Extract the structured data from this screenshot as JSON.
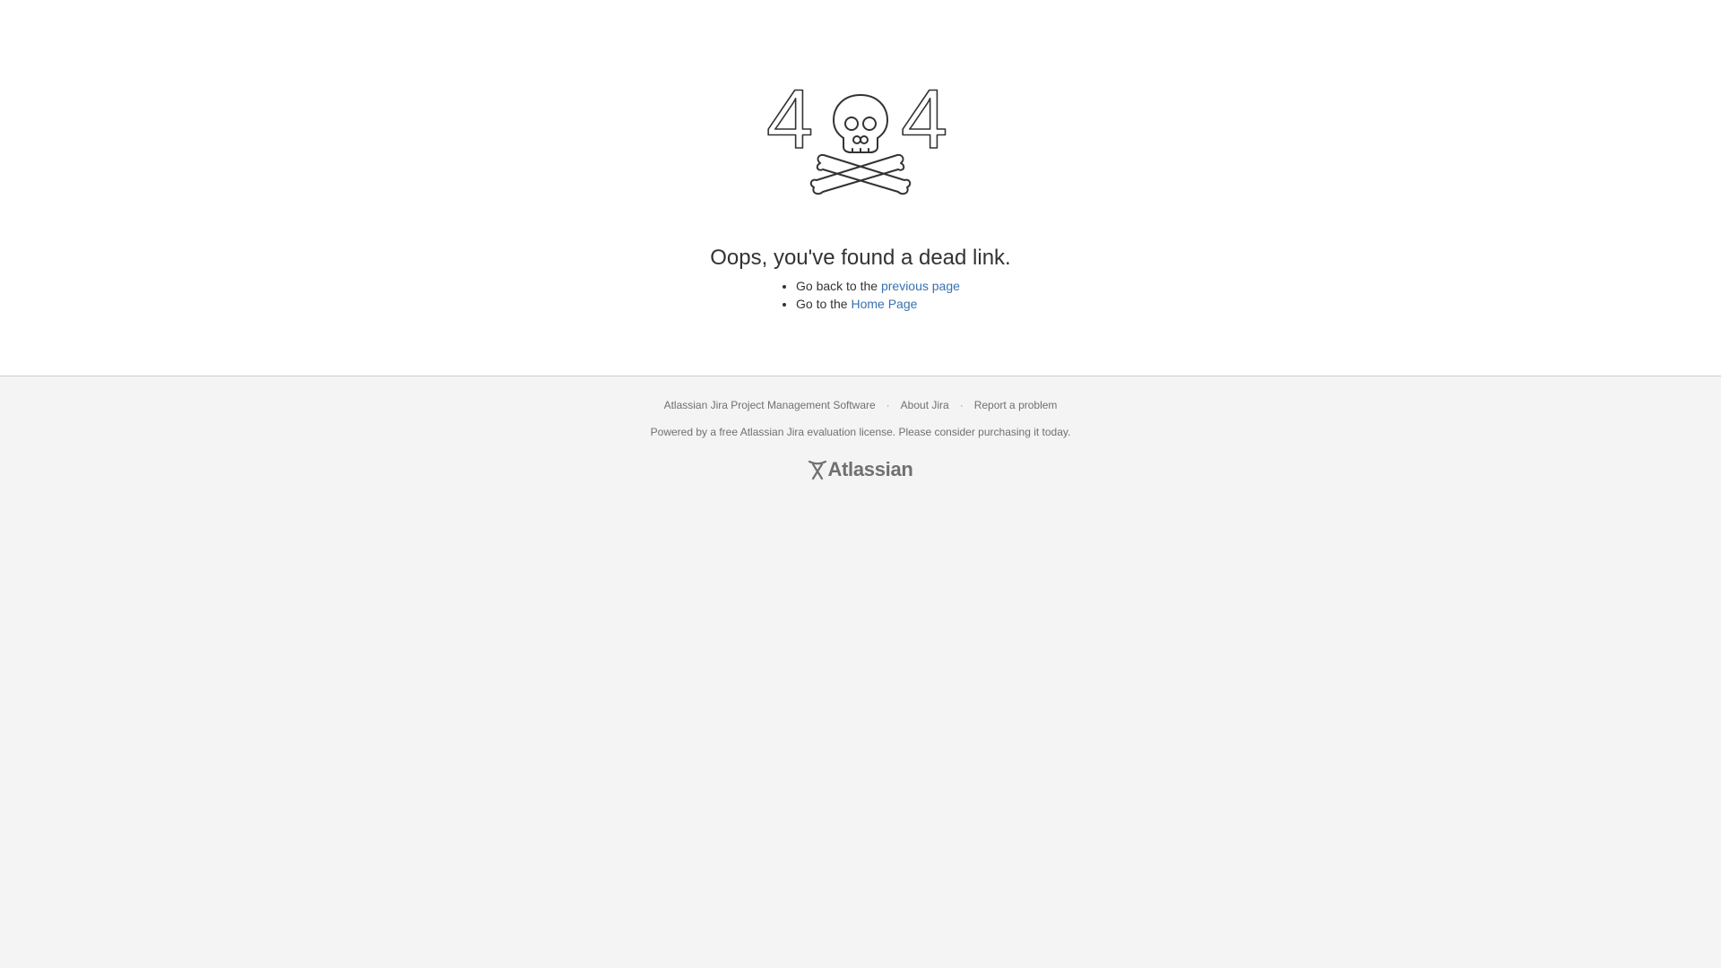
{
  "error": {
    "code_digit_left": "4",
    "code_digit_right": "4",
    "title": "Oops, you've found a dead link.",
    "links": [
      {
        "prefix": "Go back to the ",
        "link_text": "previous page"
      },
      {
        "prefix": "Go to the ",
        "link_text": "Home Page"
      }
    ]
  },
  "footer": {
    "links": [
      "Atlassian Jira Project Management Software",
      "About Jira",
      "Report a problem"
    ],
    "separator": "·",
    "license_text": "Powered by a free Atlassian Jira evaluation license. Please consider purchasing it today.",
    "logo_text": "Atlassian"
  },
  "colors": {
    "link": "#3572b0",
    "footer_text": "#707070",
    "footer_background": "#f4f4f4",
    "illustration_stroke": "#333333"
  },
  "icons": {
    "illustration": "skull-and-crossbones-404",
    "logo": "atlassian-logo"
  }
}
